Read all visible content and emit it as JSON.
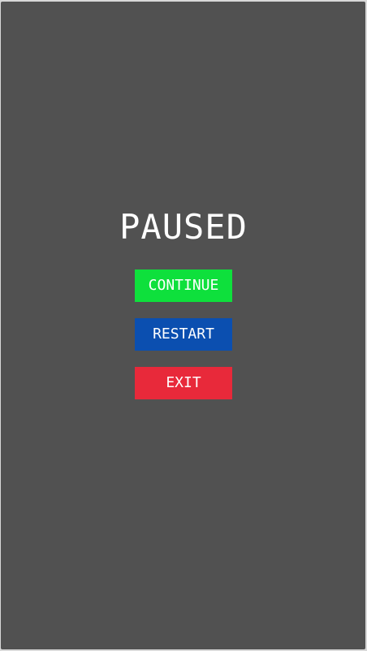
{
  "pause_menu": {
    "title": "PAUSED",
    "buttons": [
      {
        "label": "CONTINUE",
        "color": "#0ee03c"
      },
      {
        "label": "RESTART",
        "color": "#0b4fb0"
      },
      {
        "label": "EXIT",
        "color": "#e8293a"
      }
    ]
  },
  "colors": {
    "screen_background": "#515151",
    "text": "#ffffff"
  }
}
